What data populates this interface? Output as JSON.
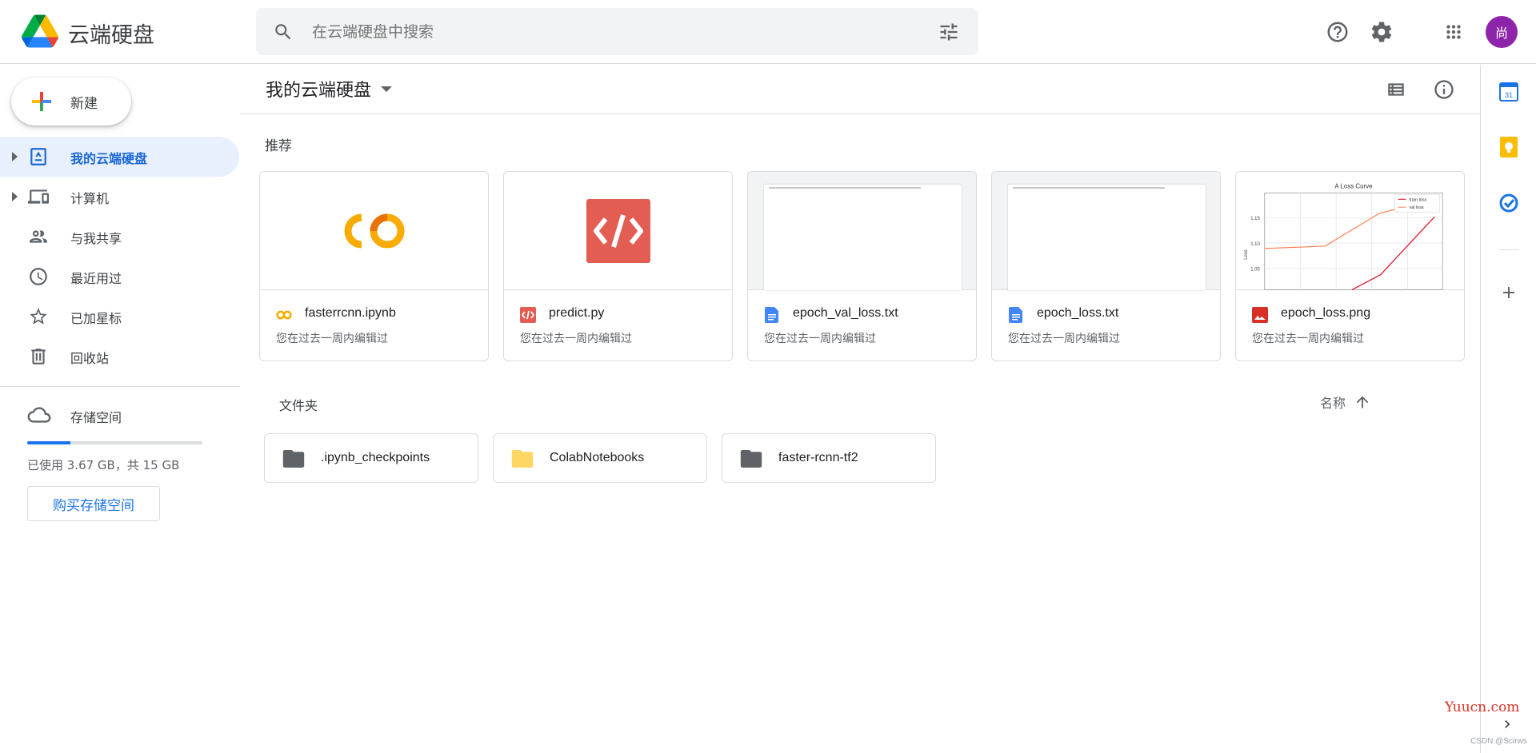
{
  "app": {
    "title": "云端硬盘",
    "logo_icon": "google-drive-logo",
    "avatar_initial": "尚",
    "avatar_color": "#8e24aa"
  },
  "search": {
    "placeholder": "在云端硬盘中搜索",
    "value": ""
  },
  "top_icons": [
    "help-icon",
    "settings-icon",
    "apps-grid-icon"
  ],
  "sidebar": {
    "new_label": "新建",
    "items": [
      {
        "label": "我的云端硬盘",
        "icon": "my-drive-icon",
        "active": true,
        "expandable": true
      },
      {
        "label": "计算机",
        "icon": "computers-icon",
        "active": false,
        "expandable": true
      },
      {
        "label": "与我共享",
        "icon": "shared-icon",
        "active": false,
        "expandable": false
      },
      {
        "label": "最近用过",
        "icon": "clock-icon",
        "active": false,
        "expandable": false
      },
      {
        "label": "已加星标",
        "icon": "star-icon",
        "active": false,
        "expandable": false
      },
      {
        "label": "回收站",
        "icon": "trash-icon",
        "active": false,
        "expandable": false
      }
    ],
    "storage": {
      "label": "存储空间",
      "used_text": "已使用 3.67 GB，共 15 GB",
      "used_fraction": 0.245,
      "buy_label": "购买存储空间"
    }
  },
  "main": {
    "title": "我的云端硬盘",
    "suggested_label": "推荐",
    "folders_label": "文件夹",
    "sort_label": "名称",
    "suggested": [
      {
        "name": "fasterrcnn.ipynb",
        "sub": "您在过去一周内编辑过",
        "type": "colab"
      },
      {
        "name": "predict.py",
        "sub": "您在过去一周内编辑过",
        "type": "code"
      },
      {
        "name": "epoch_val_loss.txt",
        "sub": "您在过去一周内编辑过",
        "type": "doc"
      },
      {
        "name": "epoch_loss.txt",
        "sub": "您在过去一周内编辑过",
        "type": "doc"
      },
      {
        "name": "epoch_loss.png",
        "sub": "您在过去一周内编辑过",
        "type": "image"
      }
    ],
    "folders": [
      {
        "name": ".ipynb_checkpoints",
        "color": "#5f6368"
      },
      {
        "name": "ColabNotebooks",
        "color": "#fdd663"
      },
      {
        "name": "faster-rcnn-tf2",
        "color": "#5f6368"
      }
    ],
    "thumbnail_chart": {
      "title": "A Loss Curve",
      "ylabel": "Loss",
      "legend": [
        "train loss",
        "val loss"
      ],
      "ticks": [
        "1.15",
        "1.10",
        "1.05"
      ]
    }
  },
  "rightbar": {
    "icons": [
      "calendar-icon",
      "keep-icon",
      "tasks-icon",
      "add-addon-icon",
      "expand-panel-icon"
    ],
    "calendar_day": "31"
  },
  "watermark": {
    "site": "Yuucn.com",
    "author": "CSDN @Scirws"
  },
  "colors": {
    "accent": "#1a73e8",
    "active_bg": "#e8f0fe",
    "colab_orange": "#f9ab00",
    "code_red": "#e35d53",
    "doc_blue": "#4285f4",
    "image_red": "#d93025"
  }
}
